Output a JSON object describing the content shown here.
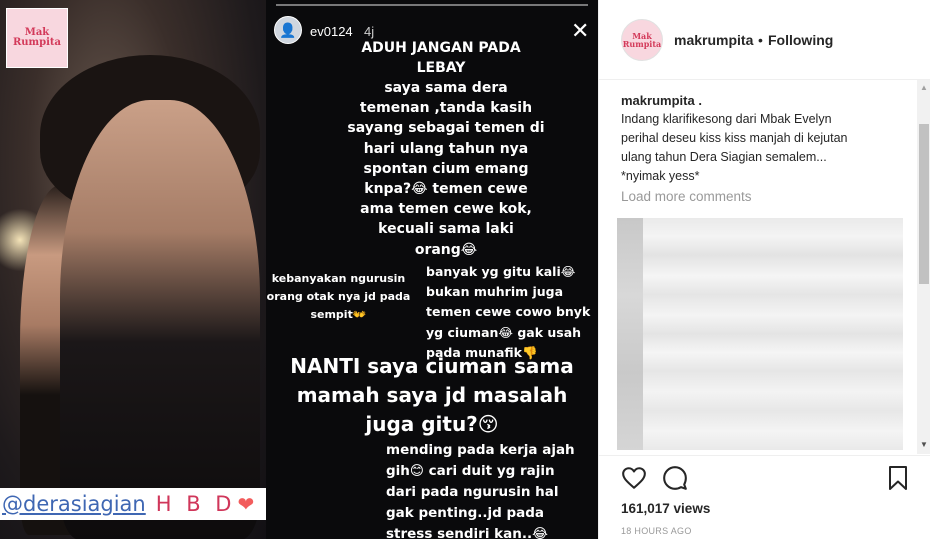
{
  "brand": {
    "logo_text": "Mak Rumpita"
  },
  "left_photo": {
    "tag_username": "@derasiagian",
    "tag_text": "H B D",
    "heart_icon": "heart-icon"
  },
  "story": {
    "username": "ev0124",
    "time": "4j",
    "close_icon": "close-icon",
    "text_1": "ADUH JANGAN PADA\nLEBAY",
    "text_2": "saya sama dera\ntemenan ,tanda kasih\nsayang sebagai temen di\nhari ulang tahun nya\nspontan cium emang\nknpa?😂 temen cewe\nama temen cewe kok,\nkecuali sama laki\norang😂",
    "text_3": "kebanyakan ngurusin\norang otak nya jd pada\nsempit👐",
    "text_4": "banyak yg gitu kali😂\nbukan muhrim juga\ntemen cewe cowo bnyk\nyg ciuman😂 gak usah\npada munafik👎",
    "text_5": "NANTI saya ciuman sama\nmamah saya jd masalah\njuga gitu?😚",
    "text_6": "mending pada kerja ajah\ngih😊 cari duit yg rajin\ndari pada ngurusin hal\ngak penting..jd pada\nstress sendiri kan..😂"
  },
  "header": {
    "username": "makrumpita",
    "separator": "•",
    "follow_status": "Following",
    "avatar_text": "Mak Rumpita"
  },
  "caption": {
    "username": "makrumpita",
    "suffix": " .",
    "lines": [
      "Indang klarifikesong dari Mbak Evelyn",
      "perihal deseu kiss kiss manjah di kejutan",
      "ulang tahun Dera Siagian semalem...",
      "*nyimak yess*"
    ]
  },
  "load_more": "Load more comments",
  "actions": {
    "like_icon": "heart-outline-icon",
    "comment_icon": "comment-icon",
    "save_icon": "bookmark-icon"
  },
  "views": "161,017 views",
  "post_time": "18 HOURS AGO"
}
